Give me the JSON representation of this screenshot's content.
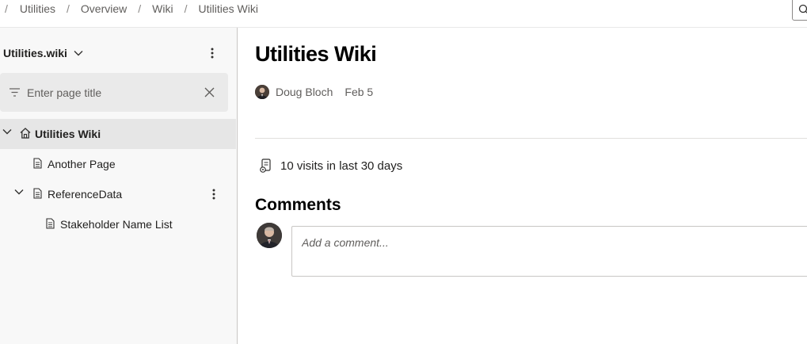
{
  "breadcrumb": {
    "items": [
      "Utilities",
      "Overview",
      "Wiki",
      "Utilities Wiki"
    ]
  },
  "sidebar": {
    "wiki_name": "Utilities.wiki",
    "filter": {
      "placeholder": "Enter page title",
      "value": ""
    },
    "tree": [
      {
        "label": "Utilities Wiki",
        "icon": "home-icon",
        "expanded": true,
        "selected": true
      },
      {
        "label": "Another Page",
        "icon": "page-icon"
      },
      {
        "label": "ReferenceData",
        "icon": "page-icon",
        "expanded": true
      },
      {
        "label": "Stakeholder Name List",
        "icon": "page-icon"
      }
    ]
  },
  "page": {
    "title": "Utilities Wiki",
    "author": "Doug Bloch",
    "date": "Feb 5",
    "visits": "10 visits in last 30 days",
    "comments_heading": "Comments",
    "comment_placeholder": "Add a comment..."
  },
  "colors": {
    "sidebar_bg": "#f8f8f8",
    "selected_row": "#e6e6e6",
    "filter_bg": "#eaeaea",
    "text_secondary": "#605e5c"
  }
}
